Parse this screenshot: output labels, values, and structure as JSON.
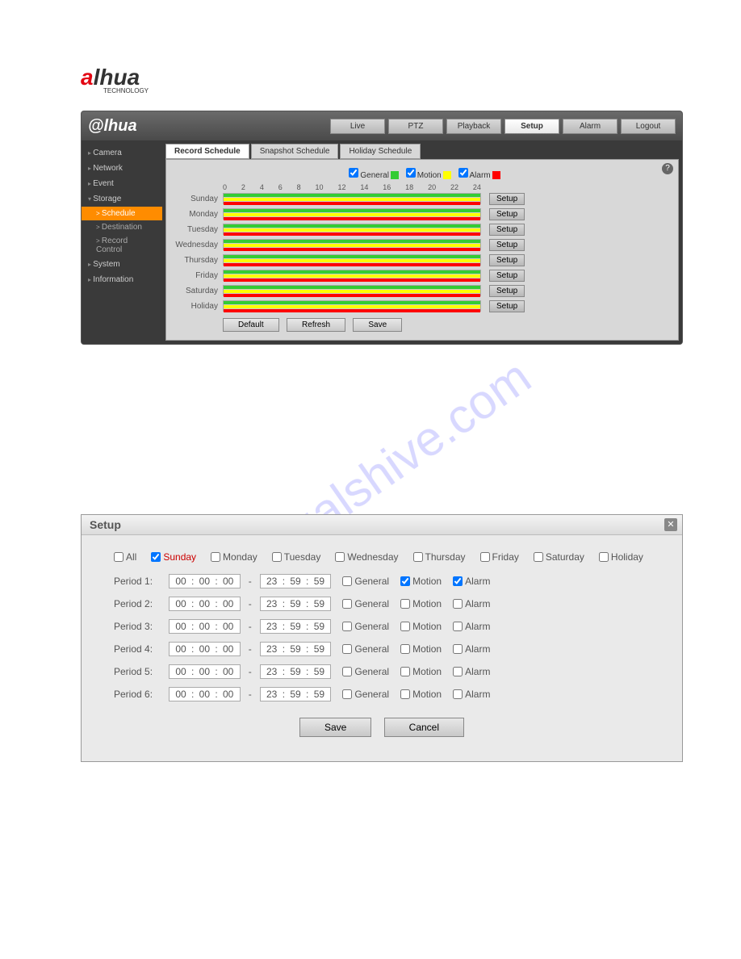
{
  "brand": {
    "prefix": "a",
    "rest": "lhua",
    "sub": "TECHNOLOGY"
  },
  "nav": [
    "Live",
    "PTZ",
    "Playback",
    "Setup",
    "Alarm",
    "Logout"
  ],
  "nav_active": "Setup",
  "sidebar": {
    "items": [
      "Camera",
      "Network",
      "Event",
      "Storage",
      "System",
      "Information"
    ],
    "storage_subs": [
      "Schedule",
      "Destination",
      "Record Control"
    ],
    "active_sub": "Schedule"
  },
  "tabs": [
    "Record Schedule",
    "Snapshot Schedule",
    "Holiday Schedule"
  ],
  "active_tab": "Record Schedule",
  "legend": {
    "general": "General",
    "motion": "Motion",
    "alarm": "Alarm"
  },
  "hours": [
    "0",
    "2",
    "4",
    "6",
    "8",
    "10",
    "12",
    "14",
    "16",
    "18",
    "20",
    "22",
    "24"
  ],
  "days": [
    "Sunday",
    "Monday",
    "Tuesday",
    "Wednesday",
    "Thursday",
    "Friday",
    "Saturday",
    "Holiday"
  ],
  "row_setup": "Setup",
  "buttons": {
    "default": "Default",
    "refresh": "Refresh",
    "save": "Save"
  },
  "dialog": {
    "title": "Setup",
    "all": "All",
    "days": [
      "Sunday",
      "Monday",
      "Tuesday",
      "Wednesday",
      "Thursday",
      "Friday",
      "Saturday",
      "Holiday"
    ],
    "checked_day": "Sunday",
    "periods": [
      {
        "label": "Period 1:",
        "start": [
          "00",
          "00",
          "00"
        ],
        "end": [
          "23",
          "59",
          "59"
        ],
        "general": false,
        "motion": true,
        "alarm": true
      },
      {
        "label": "Period 2:",
        "start": [
          "00",
          "00",
          "00"
        ],
        "end": [
          "23",
          "59",
          "59"
        ],
        "general": false,
        "motion": false,
        "alarm": false
      },
      {
        "label": "Period 3:",
        "start": [
          "00",
          "00",
          "00"
        ],
        "end": [
          "23",
          "59",
          "59"
        ],
        "general": false,
        "motion": false,
        "alarm": false
      },
      {
        "label": "Period 4:",
        "start": [
          "00",
          "00",
          "00"
        ],
        "end": [
          "23",
          "59",
          "59"
        ],
        "general": false,
        "motion": false,
        "alarm": false
      },
      {
        "label": "Period 5:",
        "start": [
          "00",
          "00",
          "00"
        ],
        "end": [
          "23",
          "59",
          "59"
        ],
        "general": false,
        "motion": false,
        "alarm": false
      },
      {
        "label": "Period 6:",
        "start": [
          "00",
          "00",
          "00"
        ],
        "end": [
          "23",
          "59",
          "59"
        ],
        "general": false,
        "motion": false,
        "alarm": false
      }
    ],
    "type_labels": {
      "general": "General",
      "motion": "Motion",
      "alarm": "Alarm"
    },
    "save": "Save",
    "cancel": "Cancel"
  },
  "watermark": "manualshive.com"
}
